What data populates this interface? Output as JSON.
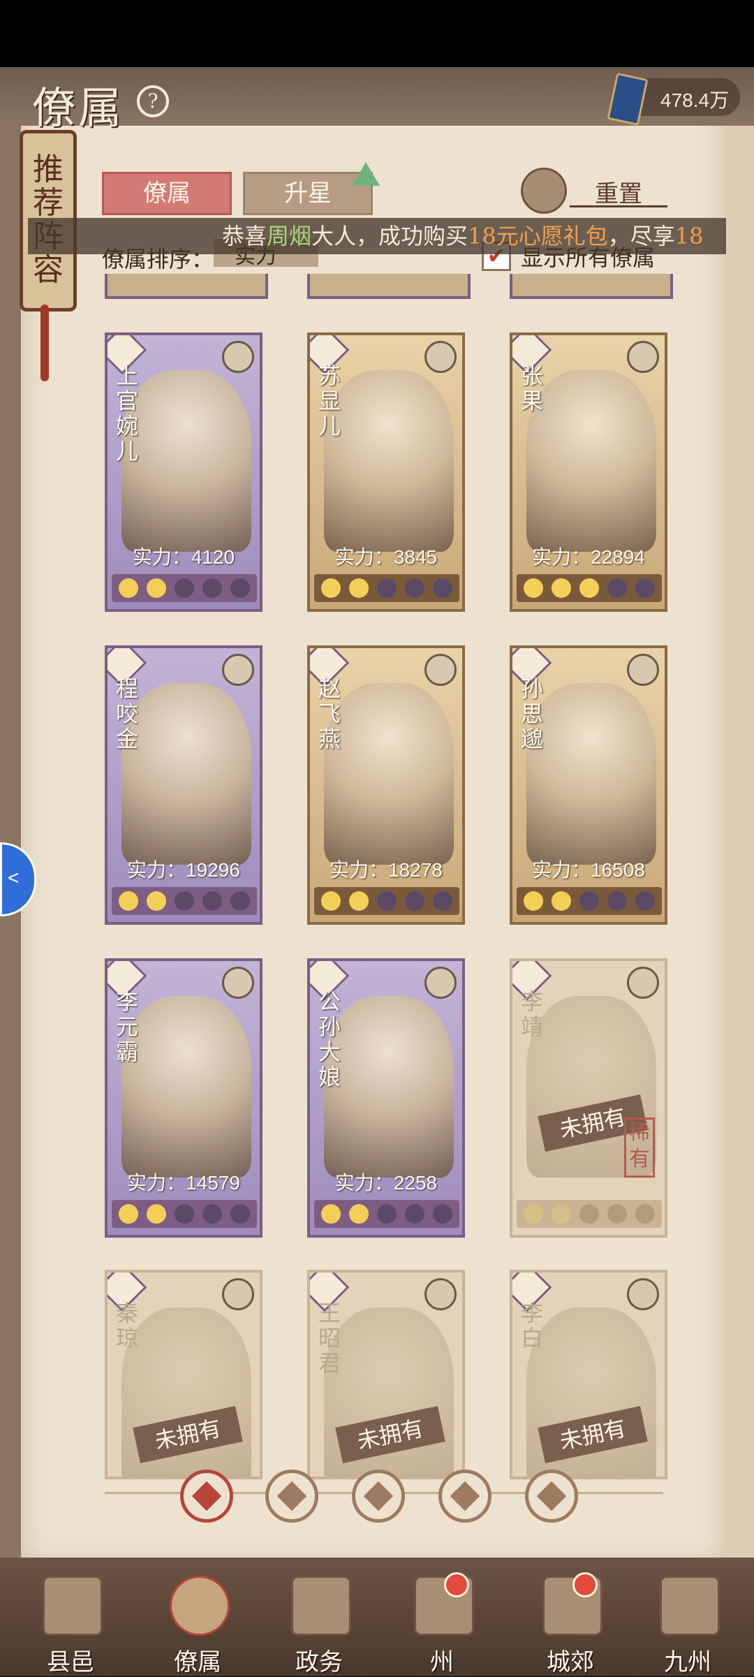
{
  "header": {
    "title": "僚属",
    "help": "?",
    "currency": "478.4万"
  },
  "side_scroll": {
    "text": "推荐阵容"
  },
  "tabs": [
    {
      "label": "僚属",
      "active": true
    },
    {
      "label": "升星",
      "active": false
    }
  ],
  "reset_label": "重置",
  "marquee": {
    "prefix": "恭喜",
    "user": "周烟",
    "mid": "大人，成功购买",
    "item": "18元心愿礼包",
    "suffix": "，尽享",
    "tail": "18"
  },
  "sort": {
    "label": "僚属排序：",
    "value": "实力"
  },
  "show_all": {
    "label": "显示所有僚属",
    "checked": true
  },
  "cards": [
    {
      "name": "上官婉儿",
      "power": "实力：4120",
      "stars": 2,
      "style": "purple"
    },
    {
      "name": "苏显儿",
      "power": "实力：3845",
      "stars": 2,
      "style": "gold"
    },
    {
      "name": "张果",
      "power": "实力：22894",
      "stars": 3,
      "style": "gold"
    },
    {
      "name": "程咬金",
      "power": "实力：19296",
      "stars": 2,
      "style": "purple"
    },
    {
      "name": "赵飞燕",
      "power": "实力：18278",
      "stars": 2,
      "style": "gold"
    },
    {
      "name": "孙思邈",
      "power": "实力：16508",
      "stars": 2,
      "style": "gold"
    },
    {
      "name": "李元霸",
      "power": "实力：14579",
      "stars": 2,
      "style": "purple"
    },
    {
      "name": "公孙大娘",
      "power": "实力：2258",
      "stars": 2,
      "style": "purple"
    },
    {
      "name": "李靖",
      "badge": "未拥有",
      "rare": "稀有",
      "stars": 2,
      "style": "locked"
    },
    {
      "name": "秦琼",
      "badge": "未拥有",
      "style": "locked"
    },
    {
      "name": "王昭君",
      "badge": "未拥有",
      "style": "locked"
    },
    {
      "name": "李白",
      "badge": "未拥有",
      "style": "locked"
    }
  ],
  "filters": [
    "all",
    "official",
    "merchant",
    "artist",
    "general"
  ],
  "nav": [
    {
      "label": "县邑",
      "badge": false
    },
    {
      "label": "僚属",
      "badge": false,
      "active": true
    },
    {
      "label": "政务",
      "badge": false
    },
    {
      "label": "州",
      "badge": true
    },
    {
      "label": "城郊",
      "badge": true
    },
    {
      "label": "九州",
      "badge": false
    }
  ],
  "colors": {
    "accent": "#b8443a",
    "tab_active": "#d27a73",
    "purple_frame": "#7d5d83"
  }
}
